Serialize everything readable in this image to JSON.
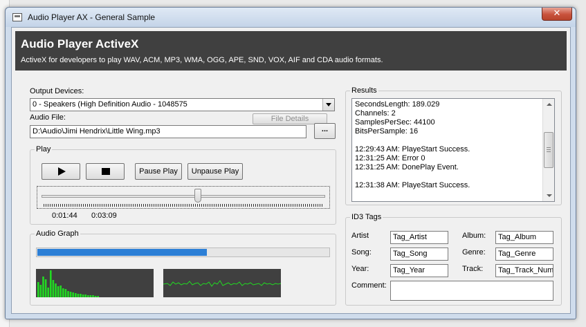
{
  "window": {
    "title": "Audio Player AX - General Sample",
    "close_label": "✕"
  },
  "banner": {
    "title": "Audio Player ActiveX",
    "subtitle": "ActiveX for developers to play WAV, ACM, MP3, WMA, OGG, APE, SND, VOX, AIF and CDA audio formats."
  },
  "output_devices": {
    "label": "Output Devices:",
    "selected": "0 - Speakers (High Definition Audio - 1048575"
  },
  "audio_file": {
    "label": "Audio File:",
    "file_details_label": "File Details",
    "path": "D:\\Audio\\Jimi Hendrix\\Little Wing.mp3",
    "browse_label": "..."
  },
  "play": {
    "group_label": "Play",
    "play_icon": "play-icon",
    "stop_icon": "stop-icon",
    "pause_label": "Pause Play",
    "unpause_label": "Unpause Play",
    "position_fraction": 0.56,
    "current_time": "0:01:44",
    "total_time": "0:03:09"
  },
  "audio_graph": {
    "group_label": "Audio Graph",
    "level_fraction": 0.58,
    "accent_color": "#2c7fd6",
    "spectrum_color": "#22d922"
  },
  "results": {
    "group_label": "Results",
    "lines": [
      "SecondsLength: 189.029",
      "Channels: 2",
      "SamplesPerSec: 44100",
      "BitsPerSample: 16",
      "",
      "12:29:43 AM: PlayeStart Success.",
      "12:31:25 AM: Error 0",
      "12:31:25 AM: DonePlay Event.",
      "",
      "12:31:38 AM: PlayeStart Success."
    ]
  },
  "id3": {
    "group_label": "ID3 Tags",
    "artist_label": "Artist",
    "artist_value": "Tag_Artist",
    "album_label": "Album:",
    "album_value": "Tag_Album",
    "song_label": "Song:",
    "song_value": "Tag_Song",
    "genre_label": "Genre:",
    "genre_value": "Tag_Genre",
    "year_label": "Year:",
    "year_value": "Tag_Year",
    "track_label": "Track:",
    "track_value": "Tag_Track_Num",
    "comment_label": "Comment:",
    "comment_value": ""
  }
}
